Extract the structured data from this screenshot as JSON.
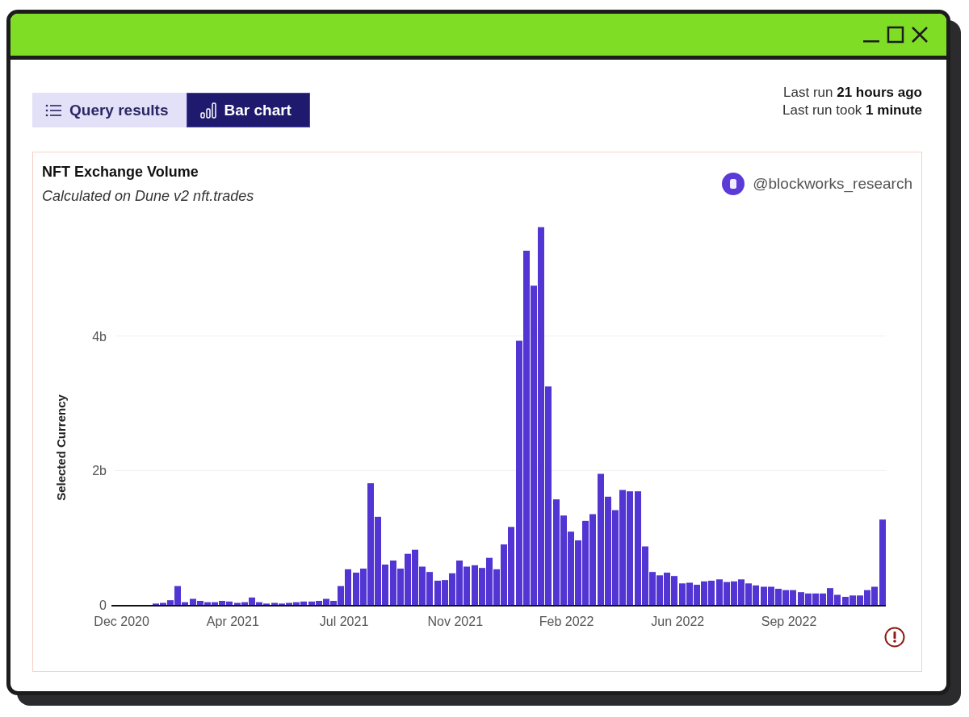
{
  "tabs": [
    {
      "label": "Query results",
      "kind": "list",
      "selected": false
    },
    {
      "label": "Bar chart",
      "kind": "bars",
      "selected": true
    }
  ],
  "last_run": [
    "Last run **21 hours ago**",
    "Last run took **1 minute**"
  ],
  "card": {
    "title": "NFT Exchange Volume",
    "subtitle": "Calculated on Dune v2 nft.trades",
    "author": "@blockworks_research",
    "chart_data": {
      "type": "bar",
      "ylabel": "Selected Currency",
      "categories": [
        "Dec 2020",
        null,
        null,
        null,
        null,
        null,
        null,
        null,
        null,
        null,
        null,
        null,
        null,
        null,
        null,
        "Apr 2021",
        null,
        null,
        null,
        null,
        null,
        null,
        null,
        null,
        null,
        null,
        null,
        null,
        null,
        null,
        "Jul 2021",
        null,
        null,
        null,
        null,
        null,
        null,
        null,
        null,
        null,
        null,
        null,
        null,
        null,
        null,
        "Nov 2021",
        null,
        null,
        null,
        null,
        null,
        null,
        null,
        null,
        null,
        null,
        null,
        null,
        null,
        null,
        "Feb 2022",
        null,
        null,
        null,
        null,
        null,
        null,
        null,
        null,
        null,
        null,
        null,
        null,
        null,
        null,
        "Jun 2022",
        null,
        null,
        null,
        null,
        null,
        null,
        null,
        null,
        null,
        null,
        null,
        null,
        null,
        null,
        "Sep 2022",
        null,
        null,
        null,
        null,
        null,
        null,
        null,
        null,
        null,
        null,
        null,
        null,
        null
      ],
      "values": [
        0,
        0,
        0,
        0,
        0,
        0.02,
        0.03,
        0.07,
        0.28,
        0.04,
        0.09,
        0.06,
        0.04,
        0.04,
        0.06,
        0.05,
        0.03,
        0.04,
        0.11,
        0.04,
        0.02,
        0.03,
        0.02,
        0.03,
        0.04,
        0.05,
        0.05,
        0.06,
        0.09,
        0.06,
        0.28,
        0.53,
        0.48,
        0.54,
        1.81,
        1.31,
        0.6,
        0.66,
        0.54,
        0.76,
        0.82,
        0.57,
        0.49,
        0.36,
        0.37,
        0.47,
        0.66,
        0.57,
        0.59,
        0.55,
        0.7,
        0.53,
        0.9,
        1.16,
        3.93,
        5.27,
        4.75,
        5.62,
        3.25,
        1.57,
        1.33,
        1.09,
        0.96,
        1.25,
        1.35,
        1.95,
        1.61,
        1.41,
        1.71,
        1.69,
        1.69,
        0.87,
        0.49,
        0.44,
        0.48,
        0.43,
        0.32,
        0.33,
        0.3,
        0.35,
        0.36,
        0.38,
        0.34,
        0.35,
        0.38,
        0.32,
        0.29,
        0.27,
        0.27,
        0.24,
        0.22,
        0.22,
        0.19,
        0.17,
        0.17,
        0.17,
        0.25,
        0.15,
        0.12,
        0.14,
        0.14,
        0.22,
        0.27,
        1.27
      ],
      "ylim": [
        0,
        5.64
      ],
      "yticks": [
        {
          "value": 0,
          "label": "0"
        },
        {
          "value": 2,
          "label": "2b"
        },
        {
          "value": 4,
          "label": "4b"
        }
      ]
    }
  }
}
